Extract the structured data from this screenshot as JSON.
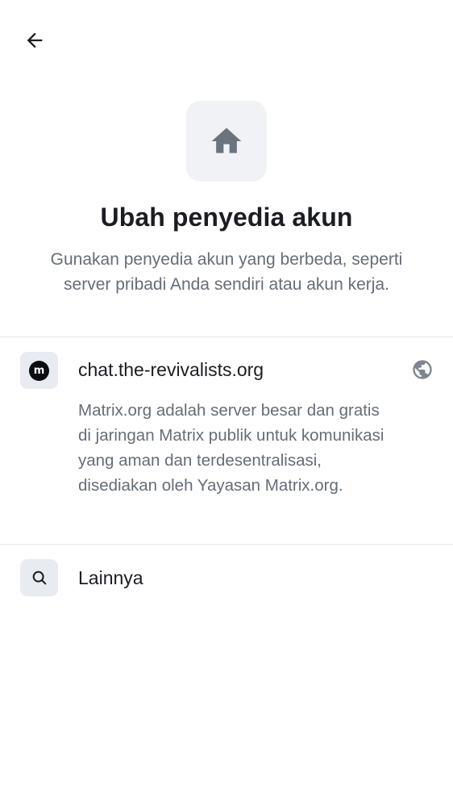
{
  "header": {
    "back_icon": "arrow-left-icon"
  },
  "hero": {
    "icon": "home-icon",
    "title": "Ubah penyedia akun",
    "subtitle": "Gunakan penyedia akun yang berbeda, seperti server pribadi Anda sendiri atau akun kerja."
  },
  "provider": {
    "logo_icon": "matrix-logo-icon",
    "logo_letter": "m",
    "name": "chat.the-revivalists.org",
    "action_icon": "globe-icon",
    "description": "Matrix.org adalah server besar dan gratis di jaringan Matrix publik untuk komunikasi yang aman dan terdesentralisasi, disediakan oleh Yayasan Matrix.org."
  },
  "other": {
    "icon": "search-icon",
    "label": "Lainnya"
  },
  "colors": {
    "primary_text": "#1b1d22",
    "secondary_text": "#656d77",
    "icon_background": "#e8ebf0",
    "divider": "#e3e6ea"
  }
}
